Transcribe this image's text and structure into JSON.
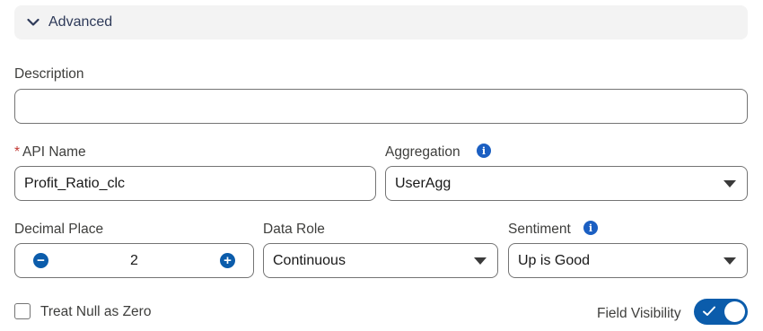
{
  "section": {
    "title": "Advanced",
    "icon": "chevron-down-icon"
  },
  "description": {
    "label": "Description",
    "value": ""
  },
  "api_name": {
    "required_marker": "*",
    "label": "API Name",
    "value": "Profit_Ratio_clc"
  },
  "aggregation": {
    "label": "Aggregation",
    "value": "UserAgg",
    "info_icon": "info-icon"
  },
  "decimal_place": {
    "label": "Decimal Place",
    "value": "2",
    "decrement_symbol": "−",
    "increment_symbol": "+"
  },
  "data_role": {
    "label": "Data Role",
    "value": "Continuous"
  },
  "sentiment": {
    "label": "Sentiment",
    "value": "Up is Good",
    "info_icon": "info-icon"
  },
  "treat_null": {
    "label": "Treat Null as Zero",
    "checked": false
  },
  "field_visibility": {
    "label": "Field Visibility",
    "on": true
  },
  "colors": {
    "brand": "#0b5cab",
    "info": "#1b5fc2",
    "required": "#c23934",
    "header_bg": "#f3f3f3"
  }
}
